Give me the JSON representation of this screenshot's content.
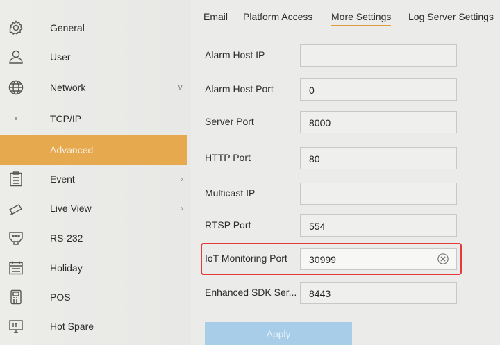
{
  "sidebar": {
    "items": [
      {
        "label": "General",
        "icon": "gear-icon"
      },
      {
        "label": "User",
        "icon": "user-icon"
      },
      {
        "label": "Network",
        "icon": "globe-icon",
        "arrow": "∨"
      },
      {
        "label": "TCP/IP",
        "icon": "dot-icon"
      },
      {
        "label": "Advanced",
        "icon": "none"
      },
      {
        "label": "Event",
        "icon": "clipboard-icon",
        "arrow": "›"
      },
      {
        "label": "Live View",
        "icon": "camera-icon",
        "arrow": "›"
      },
      {
        "label": "RS-232",
        "icon": "port-icon"
      },
      {
        "label": "Holiday",
        "icon": "calendar-icon"
      },
      {
        "label": "POS",
        "icon": "pos-icon"
      },
      {
        "label": "Hot Spare",
        "icon": "server-icon"
      }
    ],
    "active_index": 4,
    "active_color": "#e7a94e"
  },
  "tabs": [
    {
      "label": "Email"
    },
    {
      "label": "Platform Access"
    },
    {
      "label": "More Settings"
    },
    {
      "label": "Log Server Settings"
    }
  ],
  "active_tab": 2,
  "form": {
    "rows": [
      {
        "label": "Alarm Host IP",
        "value": ""
      },
      {
        "label": "Alarm Host Port",
        "value": "0"
      },
      {
        "label": "Server Port",
        "value": "8000"
      },
      {
        "label": "HTTP Port",
        "value": "80"
      },
      {
        "label": "Multicast IP",
        "value": ""
      },
      {
        "label": "RTSP Port",
        "value": "554"
      },
      {
        "label": "IoT Monitoring Port",
        "value": "30999"
      },
      {
        "label": "Enhanced SDK Ser...",
        "value": "8443"
      }
    ],
    "apply_label": "Apply"
  },
  "highlight_color": "#e53a3a"
}
